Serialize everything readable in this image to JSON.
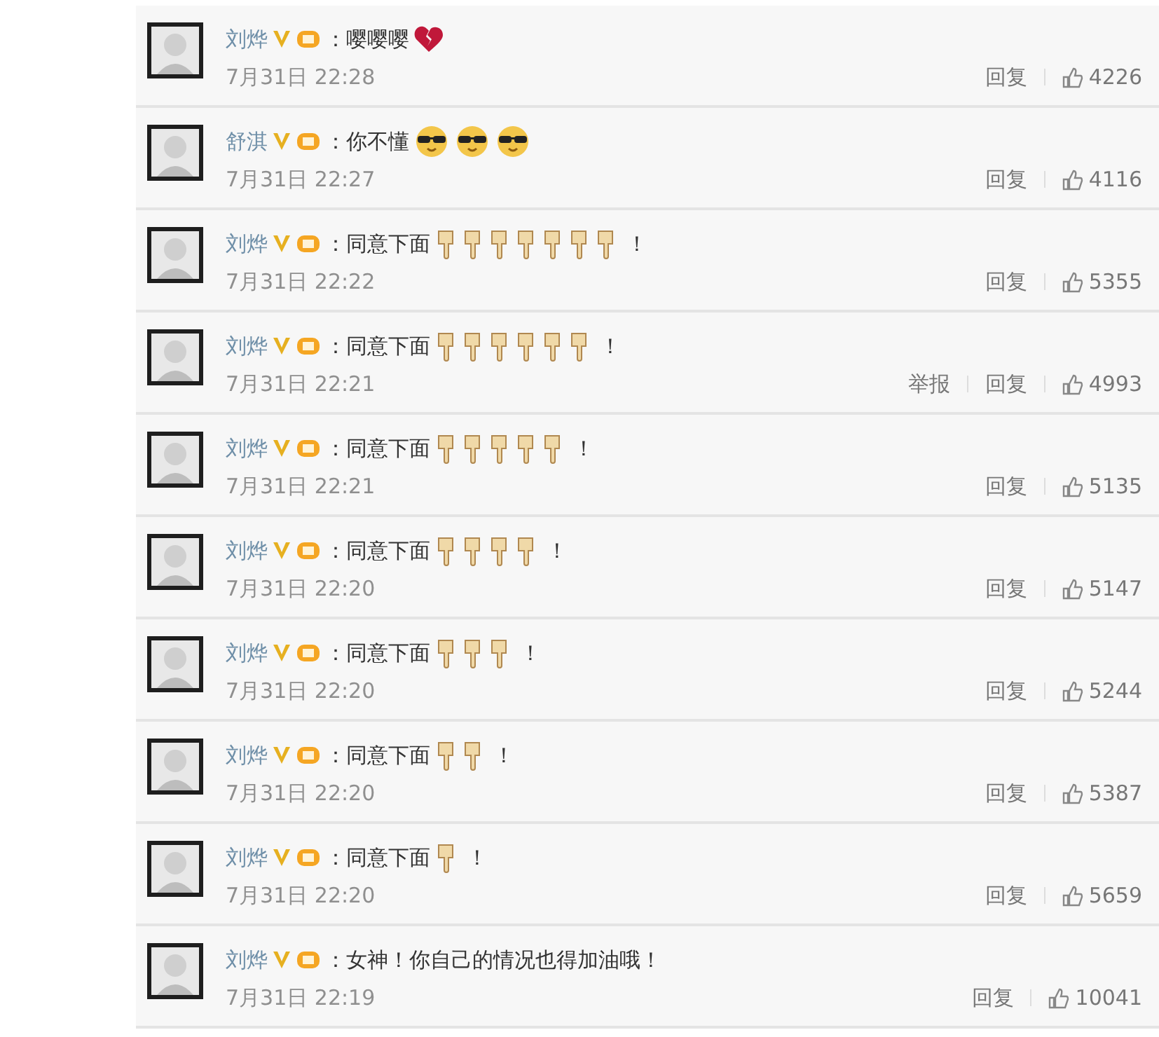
{
  "comments": [
    {
      "user": "刘烨",
      "verified": true,
      "member": true,
      "avatar": {
        "kind": "picture"
      },
      "text": "：嘤嘤嘤",
      "emojis": [
        {
          "kind": "broken-heart"
        }
      ],
      "time": "7月31日 22:28",
      "reply": "回复",
      "likes": "4226"
    },
    {
      "user": "舒淇",
      "verified": true,
      "member": true,
      "avatar": {
        "kind": "picture"
      },
      "text": "：你不懂",
      "emojis": [
        {
          "kind": "sunglasses"
        },
        {
          "kind": "sunglasses"
        },
        {
          "kind": "sunglasses"
        }
      ],
      "time": "7月31日 22:27",
      "reply": "回复",
      "likes": "4116"
    },
    {
      "user": "刘烨",
      "verified": true,
      "member": true,
      "avatar": {
        "kind": "picture"
      },
      "text": "：同意下面",
      "emojis": [
        {
          "kind": "point-down"
        },
        {
          "kind": "point-down"
        },
        {
          "kind": "point-down"
        },
        {
          "kind": "point-down"
        },
        {
          "kind": "point-down"
        },
        {
          "kind": "point-down"
        },
        {
          "kind": "point-down"
        }
      ],
      "tail": "！",
      "time": "7月31日 22:22",
      "reply": "回复",
      "likes": "5355"
    },
    {
      "user": "刘烨",
      "verified": true,
      "member": true,
      "avatar": {
        "kind": "picture"
      },
      "text": "：同意下面",
      "emojis": [
        {
          "kind": "point-down"
        },
        {
          "kind": "point-down"
        },
        {
          "kind": "point-down"
        },
        {
          "kind": "point-down"
        },
        {
          "kind": "point-down"
        },
        {
          "kind": "point-down"
        }
      ],
      "tail": "！",
      "time": "7月31日 22:21",
      "report": "举报",
      "reply": "回复",
      "likes": "4993"
    },
    {
      "user": "刘烨",
      "verified": true,
      "member": true,
      "avatar": {
        "kind": "picture"
      },
      "text": "：同意下面",
      "emojis": [
        {
          "kind": "point-down"
        },
        {
          "kind": "point-down"
        },
        {
          "kind": "point-down"
        },
        {
          "kind": "point-down"
        },
        {
          "kind": "point-down"
        }
      ],
      "tail": "！",
      "time": "7月31日 22:21",
      "reply": "回复",
      "likes": "5135"
    },
    {
      "user": "刘烨",
      "verified": true,
      "member": true,
      "avatar": {
        "kind": "picture"
      },
      "text": "：同意下面",
      "emojis": [
        {
          "kind": "point-down"
        },
        {
          "kind": "point-down"
        },
        {
          "kind": "point-down"
        },
        {
          "kind": "point-down"
        }
      ],
      "tail": "！",
      "time": "7月31日 22:20",
      "reply": "回复",
      "likes": "5147"
    },
    {
      "user": "刘烨",
      "verified": true,
      "member": true,
      "avatar": {
        "kind": "picture"
      },
      "text": "：同意下面",
      "emojis": [
        {
          "kind": "point-down"
        },
        {
          "kind": "point-down"
        },
        {
          "kind": "point-down"
        }
      ],
      "tail": "！",
      "time": "7月31日 22:20",
      "reply": "回复",
      "likes": "5244"
    },
    {
      "user": "刘烨",
      "verified": true,
      "member": true,
      "avatar": {
        "kind": "picture"
      },
      "text": "：同意下面",
      "emojis": [
        {
          "kind": "point-down"
        },
        {
          "kind": "point-down"
        }
      ],
      "tail": "！",
      "time": "7月31日 22:20",
      "reply": "回复",
      "likes": "5387"
    },
    {
      "user": "刘烨",
      "verified": true,
      "member": true,
      "avatar": {
        "kind": "picture"
      },
      "text": "：同意下面",
      "emojis": [
        {
          "kind": "point-down"
        }
      ],
      "tail": "！",
      "time": "7月31日 22:20",
      "reply": "回复",
      "likes": "5659"
    },
    {
      "user": "刘烨",
      "verified": true,
      "member": true,
      "avatar": {
        "kind": "picture"
      },
      "text": "：女神！你自己的情况也得加油哦！",
      "time": "7月31日 22:19",
      "reply": "回复",
      "likes": "10041"
    }
  ]
}
